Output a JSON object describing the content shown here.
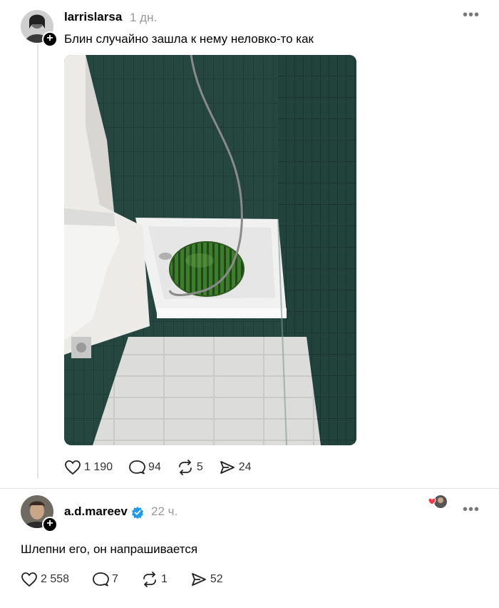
{
  "post1": {
    "username": "larrislarsa",
    "time": "1 дн.",
    "text": "Блин случайно зашла к нему неловко-то как",
    "likes": "1 190",
    "comments": "94",
    "reposts": "5",
    "shares": "24"
  },
  "post2": {
    "username": "a.d.mareev",
    "time": "22 ч.",
    "text": "Шлепни его, он напрашивается",
    "likes": "2 558",
    "comments": "7",
    "reposts": "1",
    "shares": "52"
  },
  "icons": [
    "heart-icon",
    "comment-icon",
    "repost-icon",
    "share-icon",
    "more-icon",
    "plus-icon",
    "verified-icon"
  ],
  "colors": {
    "verified": "#1d9bf0",
    "liked_heart": "#ff3040"
  }
}
